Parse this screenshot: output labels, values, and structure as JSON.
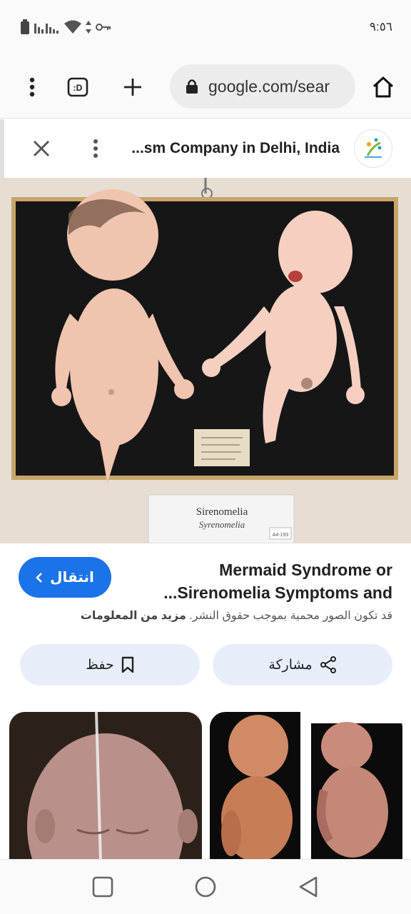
{
  "status_bar": {
    "time": "٩:٥٦"
  },
  "toolbar": {
    "url": "google.com/sear"
  },
  "viewer": {
    "title": "...sm Company in Delhi, India"
  },
  "image": {
    "plaque_title": "Sirenomelia",
    "plaque_subtitle": "Syrenomelia",
    "plaque_code": "A4-193"
  },
  "caption": {
    "title": "Mermaid Syndrome or ...Sirenomelia Symptoms and",
    "visit_label": "انتقال",
    "copyright_text": "قد تكون الصور محمية بموجب حقوق النشر.",
    "more_info_label": "مزيد من المعلومات"
  },
  "actions": {
    "share_label": "مشاركة",
    "save_label": "حفظ"
  },
  "colors": {
    "accent": "#1a73e8",
    "chip_bg": "#e8eef9"
  }
}
